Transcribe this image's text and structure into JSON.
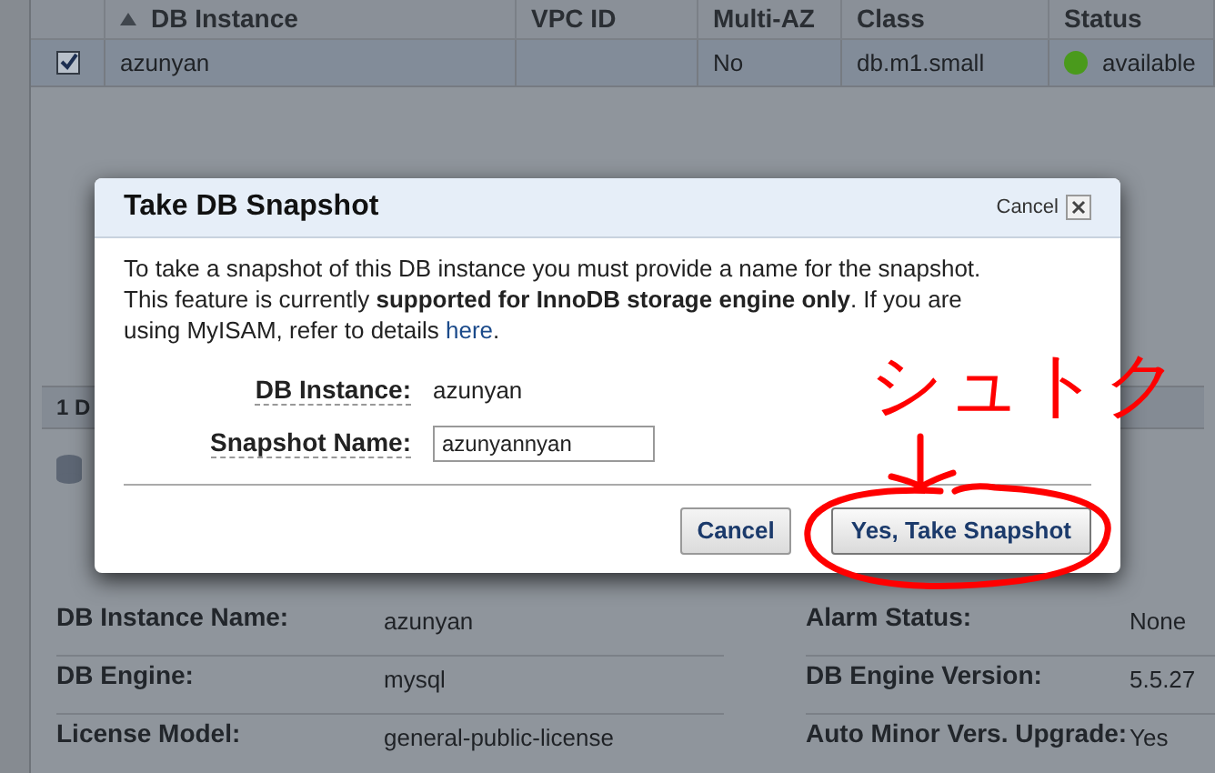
{
  "table": {
    "columns": [
      {
        "label": "DB Instance",
        "sorted": true
      },
      {
        "label": "VPC ID",
        "sorted": false
      },
      {
        "label": "Multi-AZ",
        "sorted": false
      },
      {
        "label": "Class",
        "sorted": false
      },
      {
        "label": "Status",
        "sorted": false
      }
    ],
    "rows": [
      {
        "selected": true,
        "cells": [
          "azunyan",
          "",
          "No",
          "db.m1.small",
          "available"
        ]
      }
    ]
  },
  "details_panel": {
    "header": "1 D",
    "left": [
      {
        "label": "DB Instance Name:",
        "value": "azunyan"
      },
      {
        "label": "DB Engine:",
        "value": "mysql"
      },
      {
        "label": "License Model:",
        "value": "general-public-license"
      }
    ],
    "right": [
      {
        "label": "Alarm Status:",
        "value": "None"
      },
      {
        "label": "DB Engine Version:",
        "value": "5.5.27"
      },
      {
        "label": "Auto Minor Vers. Upgrade:",
        "value": "Yes"
      }
    ]
  },
  "dialog": {
    "title": "Take DB Snapshot",
    "close_label": "Cancel",
    "message": "To take a snapshot of this DB instance you must provide a name for the snapshot. This feature is currently **supported for InnoDB storage engine only**. If you are using MyISAM, refer to details ",
    "link": "here",
    "message_end": ".",
    "fields": [
      {
        "label": "DB Instance:",
        "kind": "text",
        "value": "azunyan"
      },
      {
        "label": "Snapshot Name:",
        "kind": "input",
        "value": "azunyannyan"
      }
    ],
    "buttons": [
      {
        "label": "Cancel",
        "primary": false
      },
      {
        "label": "Yes, Take Snapshot",
        "primary": true
      }
    ]
  },
  "annotation": {
    "text": "シュトク"
  }
}
